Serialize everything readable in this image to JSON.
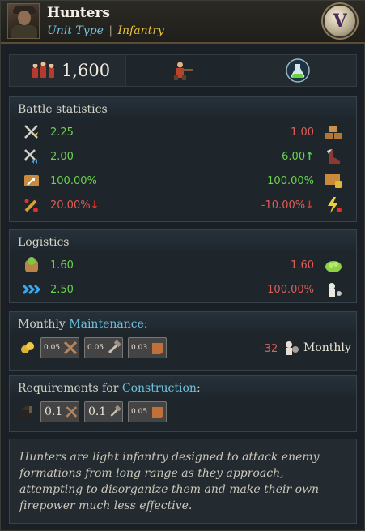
{
  "header": {
    "title": "Hunters",
    "link_label": "Unit Type",
    "separator": "|",
    "unit_type": "Infantry",
    "badge": "V"
  },
  "topbar": {
    "men_count": "1,600",
    "icons": [
      "soldiers-icon",
      "hunter-icon",
      "flask-icon"
    ]
  },
  "battle": {
    "title": "Battle statistics",
    "rows": [
      {
        "left_icon": "melee-attack-icon",
        "left_value": "2.25",
        "right_value": "1.00",
        "right_icon": "fortification-icon",
        "left_color": "green",
        "right_color": "red"
      },
      {
        "left_icon": "ranged-attack-icon",
        "left_value": "2.00",
        "right_value": "6.00",
        "right_arrow": "↑",
        "right_icon": "boot-icon",
        "left_color": "green",
        "right_color": "green"
      },
      {
        "left_icon": "organization-icon",
        "left_value": "100.00%",
        "right_value": "100.00%",
        "right_icon": "supply-icon",
        "left_color": "green",
        "right_color": "green"
      },
      {
        "left_icon": "flank-icon",
        "left_value": "20.00%",
        "left_arrow": "↓",
        "right_value": "-10.00%",
        "right_arrow": "↓",
        "right_icon": "lightning-icon",
        "left_color": "red",
        "right_color": "red"
      }
    ]
  },
  "logistics": {
    "title": "Logistics",
    "rows": [
      {
        "left_icon": "food-sack-icon",
        "left_value": "1.60",
        "right_value": "1.60",
        "right_icon": "vegetables-icon",
        "left_color": "green",
        "right_color": "red"
      },
      {
        "left_icon": "speed-chevrons-icon",
        "left_value": "2.50",
        "right_value": "100.00%",
        "right_icon": "attrition-icon",
        "left_color": "green",
        "right_color": "red"
      }
    ]
  },
  "maintenance": {
    "title_prefix": "Monthly ",
    "title_link": "Maintenance",
    "title_suffix": ":",
    "costs": [
      {
        "value": "0.05",
        "icon": "tools-icon"
      },
      {
        "value": "0.05",
        "icon": "hammer-icon"
      },
      {
        "value": "0.03",
        "icon": "leather-icon"
      }
    ],
    "manpower": "-32",
    "monthly_label": "Monthly"
  },
  "construction": {
    "title_prefix": "Requirements for ",
    "title_link": "Construction",
    "title_suffix": ":",
    "costs": [
      {
        "value": "0.1",
        "icon": "tools-icon"
      },
      {
        "value": "0.1",
        "icon": "hammer-icon"
      },
      {
        "value": "0.05",
        "icon": "leather-icon"
      }
    ]
  },
  "description": "Hunters are light infantry designed to attack enemy formations from long range as they approach, attempting to disorganize them and make their own firepower much less effective."
}
